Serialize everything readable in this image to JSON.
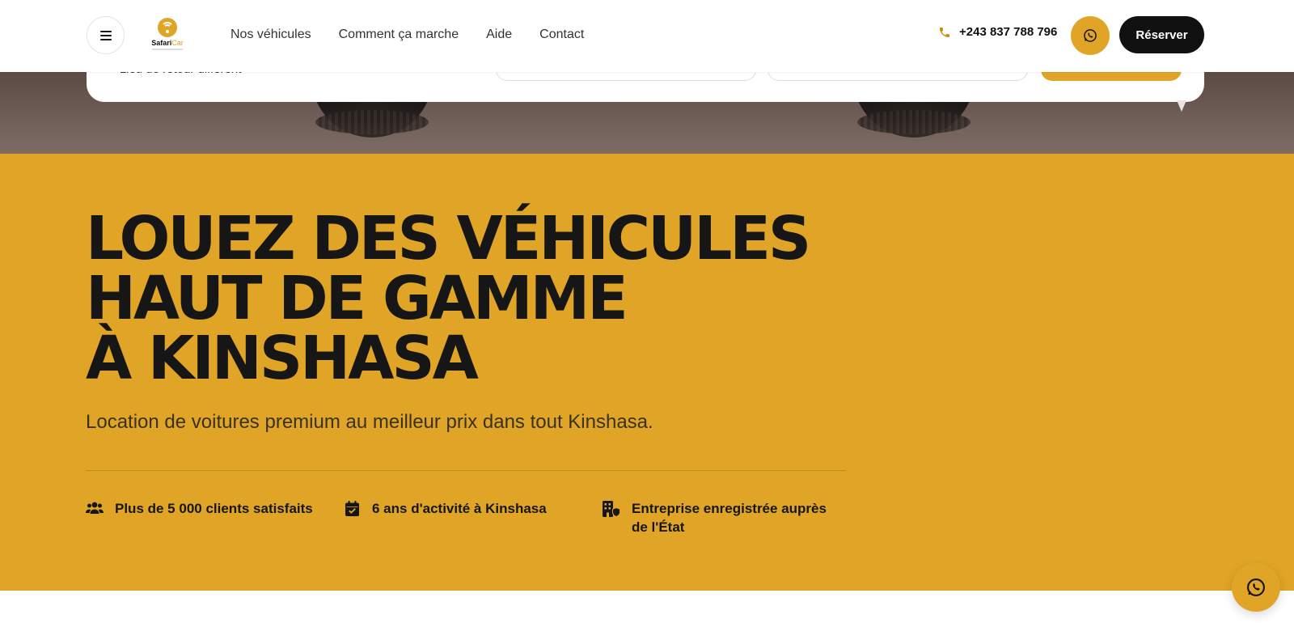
{
  "header": {
    "logo": {
      "name_dark": "Safari",
      "name_gold": "Car"
    },
    "nav": [
      "Nos véhicules",
      "Comment ça marche",
      "Aide",
      "Contact"
    ],
    "phone": "+243 837 788 796",
    "reserve_label": "Réserver",
    "icons": {
      "menu": "hamburger-icon",
      "phone": "phone-icon",
      "whatsapp": "whatsapp-icon"
    }
  },
  "booking": {
    "return_option": "Lieu de retour différent"
  },
  "hero": {
    "title_lines": [
      "LOUEZ DES VÉHICULES",
      "HAUT DE GAMME",
      "À KINSHASA"
    ],
    "subtitle": "Location de voitures premium au meilleur prix dans tout Kinshasa.",
    "features": [
      {
        "icon": "users-icon",
        "text": "Plus de 5 000 clients satisfaits"
      },
      {
        "icon": "calendar-check-icon",
        "text": "6 ans d'activité à Kinshasa"
      },
      {
        "icon": "building-shield-icon",
        "text": "Entreprise enregistrée auprès de l'État"
      }
    ]
  },
  "colors": {
    "accent": "#e0a526",
    "dark": "#111111",
    "background": "#ffffff"
  }
}
